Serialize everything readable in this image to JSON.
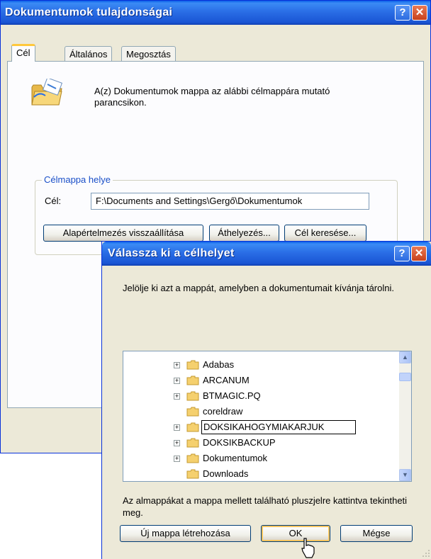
{
  "main_window": {
    "title": "Dokumentumok tulajdonságai",
    "help_glyph": "?",
    "close_glyph": "✕",
    "tabs": [
      {
        "label": "Cél",
        "active": true
      },
      {
        "label": "Általános",
        "active": false
      },
      {
        "label": "Megosztás",
        "active": false
      }
    ],
    "description": "A(z) Dokumentumok mappa az alábbi célmappára mutató parancsikon.",
    "group_title": "Célmappa helye",
    "target_label": "Cél:",
    "target_value": "F:\\Documents and Settings\\Gergő\\Dokumentumok",
    "buttons": {
      "restore": "Alapértelmezés visszaállítása",
      "move": "Áthelyezés...",
      "find": "Cél keresése..."
    }
  },
  "dialog": {
    "title": "Válassza ki a célhelyet",
    "help_glyph": "?",
    "close_glyph": "✕",
    "instruction": "Jelölje ki azt a mappát, amelyben a dokumentumait kívánja tárolni.",
    "tree_items": [
      {
        "label": "Adabas",
        "expandable": true
      },
      {
        "label": "ARCANUM",
        "expandable": true
      },
      {
        "label": "BTMAGIC.PQ",
        "expandable": true
      },
      {
        "label": "coreldraw",
        "expandable": false
      },
      {
        "label": "DOKSIKAHOGYMIAKARJUK",
        "expandable": true,
        "editing": true
      },
      {
        "label": "DOKSIKBACKUP",
        "expandable": true
      },
      {
        "label": "Dokumentumok",
        "expandable": true
      },
      {
        "label": "Downloads",
        "expandable": false
      }
    ],
    "hint": "Az almappákat a mappa mellett található pluszjelre kattintva tekintheti meg.",
    "buttons": {
      "new_folder": "Új mappa létrehozása",
      "ok": "OK",
      "cancel": "Mégse"
    }
  },
  "colors": {
    "titlebar": "#2a6ee6",
    "window_bg": "#ece9d8",
    "group_title": "#1a4fc8",
    "active_tab_accent": "#ffc83c",
    "close_button": "#c8411c"
  },
  "icons": [
    "folder-shortcut-icon",
    "folder-icon",
    "plus-icon",
    "help-icon",
    "close-icon",
    "mouse-cursor-icon"
  ]
}
